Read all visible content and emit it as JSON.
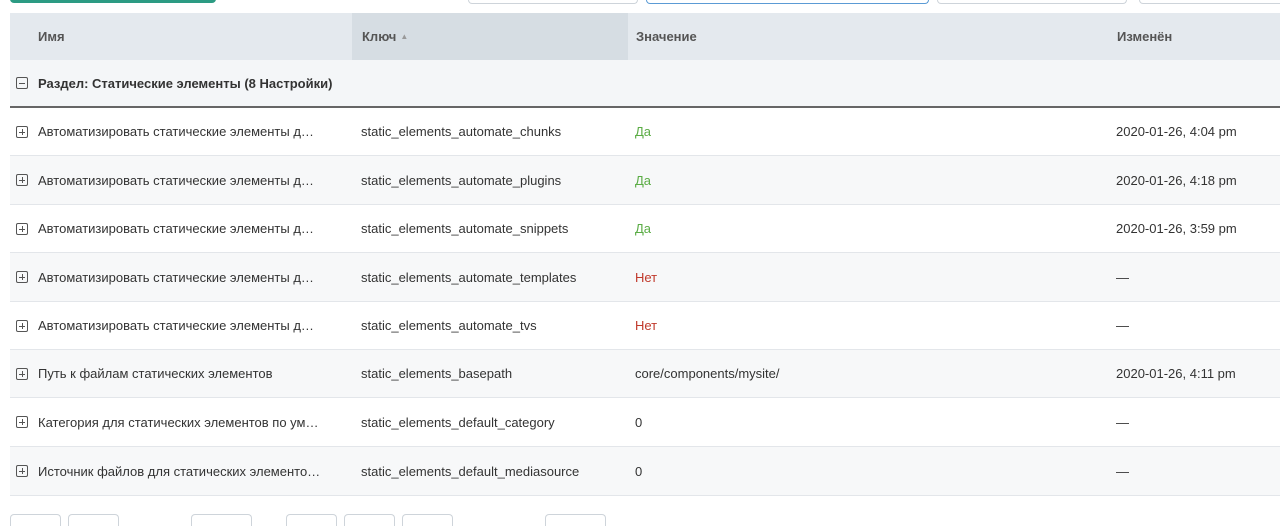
{
  "grid": {
    "columns": {
      "name": "Имя",
      "key": "Ключ",
      "value": "Значение",
      "modified": "Изменён"
    },
    "group_label": "Раздел: Статические элементы (8 Настройки)",
    "rows": [
      {
        "name": "Автоматизировать статические элементы д…",
        "key": "static_elements_automate_chunks",
        "value": "Да",
        "modified": "2020-01-26, 4:04 pm"
      },
      {
        "name": "Автоматизировать статические элементы д…",
        "key": "static_elements_automate_plugins",
        "value": "Да",
        "modified": "2020-01-26, 4:18 pm"
      },
      {
        "name": "Автоматизировать статические элементы д…",
        "key": "static_elements_automate_snippets",
        "value": "Да",
        "modified": "2020-01-26, 3:59 pm"
      },
      {
        "name": "Автоматизировать статические элементы д…",
        "key": "static_elements_automate_templates",
        "value": "Нет",
        "modified": "—"
      },
      {
        "name": "Автоматизировать статические элементы д…",
        "key": "static_elements_automate_tvs",
        "value": "Нет",
        "modified": "—"
      },
      {
        "name": "Путь к файлам статических элементов",
        "key": "static_elements_basepath",
        "value": "core/components/mysite/",
        "modified": "2020-01-26, 4:11 pm"
      },
      {
        "name": "Категория для статических элементов по ум…",
        "key": "static_elements_default_category",
        "value": "0",
        "modified": "—"
      },
      {
        "name": "Источник файлов для статических элементо…",
        "key": "static_elements_default_mediasource",
        "value": "0",
        "modified": "—"
      }
    ]
  },
  "colors": {
    "yes": "#5aac44",
    "no": "#c0392b",
    "accent": "#2c9b83"
  }
}
